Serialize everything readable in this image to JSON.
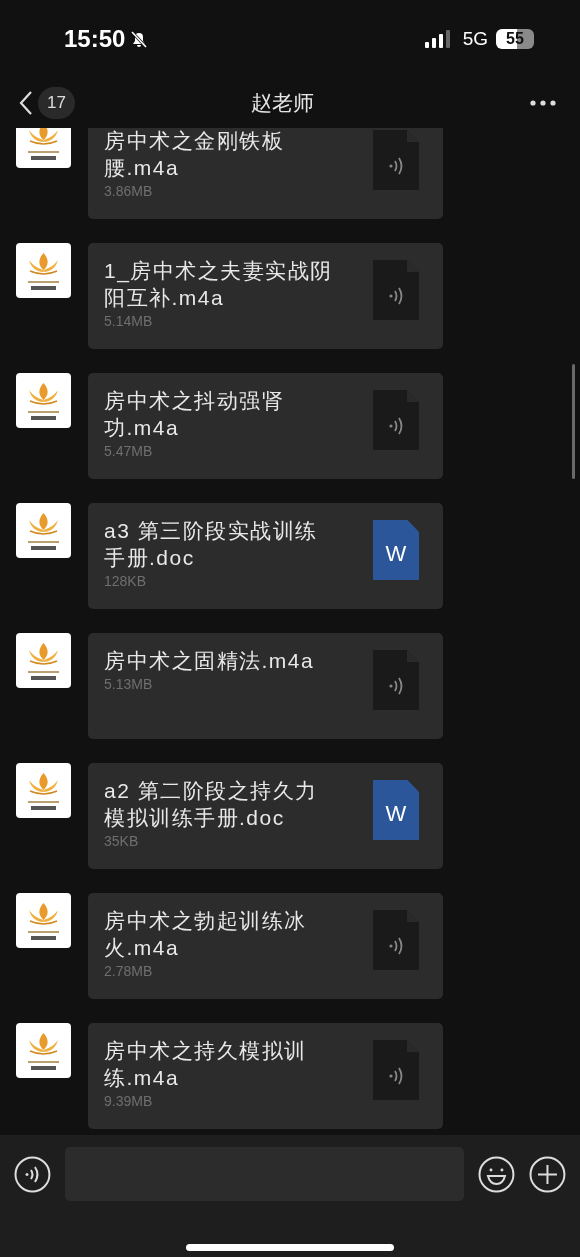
{
  "status_bar": {
    "time": "15:50",
    "muted": true,
    "network": "5G",
    "battery": "55"
  },
  "nav": {
    "unread": "17",
    "title": "赵老师"
  },
  "messages": [
    {
      "kind": "audio",
      "name": "房中术之金刚铁板腰.m4a",
      "size": "3.86MB"
    },
    {
      "kind": "audio",
      "name": "1_房中术之夫妻实战阴阳互补.m4a",
      "size": "5.14MB"
    },
    {
      "kind": "audio",
      "name": "房中术之抖动强肾功.m4a",
      "size": "5.47MB"
    },
    {
      "kind": "doc",
      "name": "a3 第三阶段实战训练手册.doc",
      "size": "128KB",
      "icon_text": "W"
    },
    {
      "kind": "audio",
      "name": "房中术之固精法.m4a",
      "size": "5.13MB"
    },
    {
      "kind": "doc",
      "name": "a2 第二阶段之持久力模拟训练手册.doc",
      "size": "35KB",
      "icon_text": "W"
    },
    {
      "kind": "audio",
      "name": "房中术之勃起训练冰火.m4a",
      "size": "2.78MB"
    },
    {
      "kind": "audio",
      "name": "房中术之持久模拟训练.m4a",
      "size": "9.39MB"
    }
  ]
}
